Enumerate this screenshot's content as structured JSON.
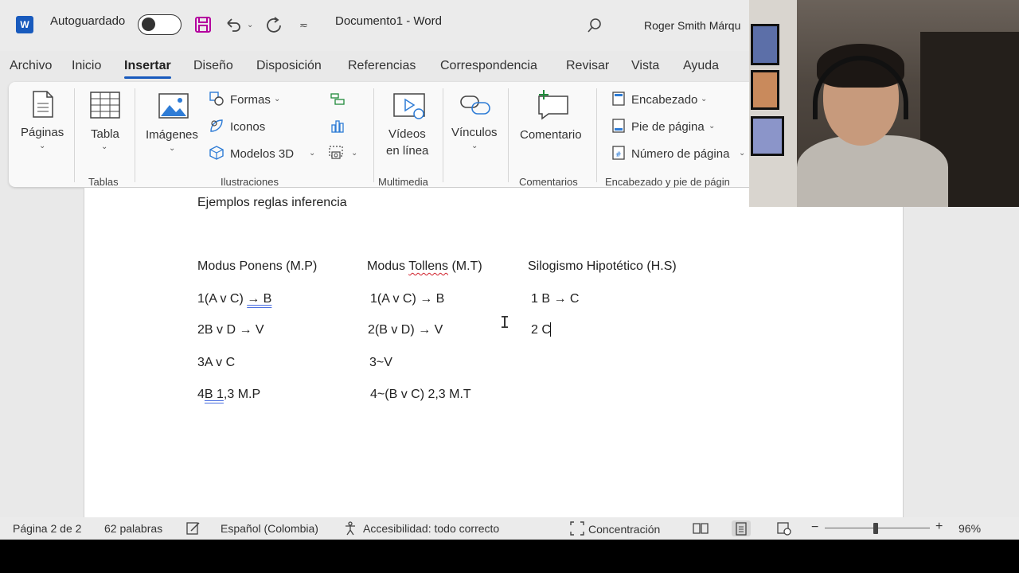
{
  "titlebar": {
    "logo_letter": "W",
    "autosave_label": "Autoguardado",
    "document_title": "Documento1  -  Word",
    "user_name": "Roger Smith Márqu"
  },
  "tabs": [
    "Archivo",
    "Inicio",
    "Insertar",
    "Diseño",
    "Disposición",
    "Referencias",
    "Correspondencia",
    "Revisar",
    "Vista",
    "Ayuda"
  ],
  "active_tab": "Insertar",
  "ribbon": {
    "paginas": "Páginas",
    "tabla": "Tabla",
    "group_tablas": "Tablas",
    "imagenes": "Imágenes",
    "formas": "Formas",
    "iconos": "Iconos",
    "modelos3d": "Modelos 3D",
    "group_ilustraciones": "Ilustraciones",
    "videos_line1": "Vídeos",
    "videos_line2": "en línea",
    "group_multimedia": "Multimedia",
    "vinculos": "Vínculos",
    "comentario": "Comentario",
    "group_comentarios": "Comentarios",
    "encabezado": "Encabezado",
    "pie_pagina": "Pie de página",
    "numero_pagina": "Número de página",
    "group_encabezado": "Encabezado y pie de págin"
  },
  "document": {
    "heading": "Ejemplos reglas inferencia",
    "col1": {
      "title": "Modus Ponens (M.P)",
      "line1_pre": "1(A v C) ",
      "line1_mark": "→  B",
      "line2": "2B v D →  V",
      "line3": "3A v C",
      "line4_pre": "4",
      "line4_mark": "B  1",
      "line4_post": ",3 M.P"
    },
    "col2": {
      "title_pre": "Modus ",
      "title_mark": "Tollens",
      "title_post": " (M.T)",
      "line1": "1(A v C) →  B",
      "line2": "2(B v D) →  V",
      "line3": "3~V",
      "line4": "4~(B v C) 2,3 M.T"
    },
    "col3": {
      "title": "Silogismo Hipotético (H.S)",
      "line1": "1 B →  C",
      "line2": "2 C"
    }
  },
  "statusbar": {
    "page": "Página 2 de 2",
    "words": "62 palabras",
    "language": "Español (Colombia)",
    "accessibility": "Accesibilidad: todo correcto",
    "focus": "Concentración",
    "zoom_percent": "96%",
    "zoom_minus": "−",
    "zoom_plus": "+"
  }
}
